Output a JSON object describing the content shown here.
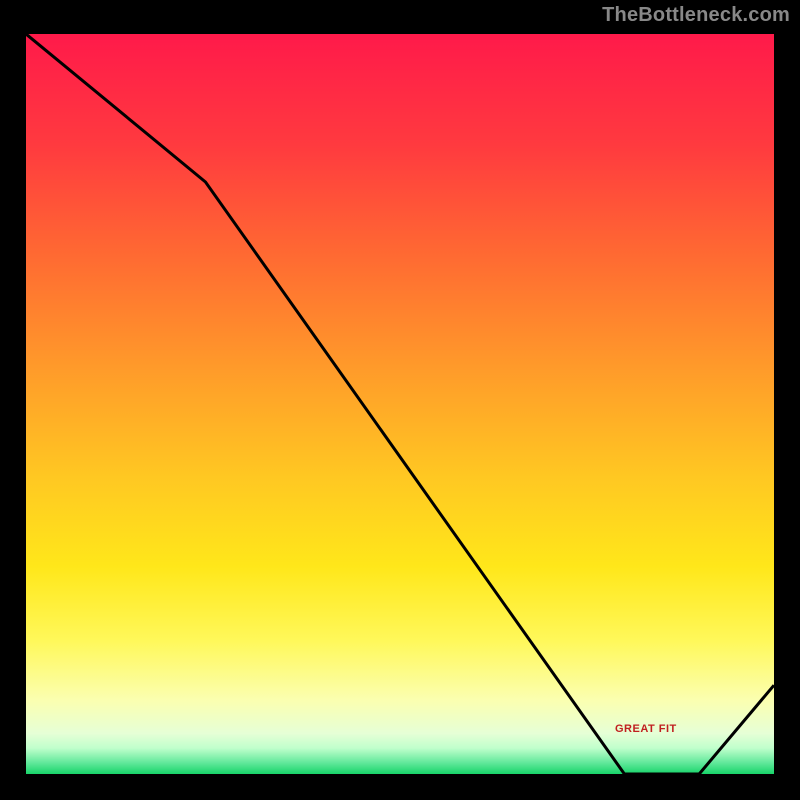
{
  "watermark": "TheBottleneck.com",
  "fit_label": "GREAT FIT",
  "colors": {
    "bg": "#000000",
    "curve": "#000000",
    "gradient_stops": [
      {
        "offset": 0.0,
        "color": "#ff1a4a"
      },
      {
        "offset": 0.15,
        "color": "#ff3a3f"
      },
      {
        "offset": 0.3,
        "color": "#ff6a32"
      },
      {
        "offset": 0.45,
        "color": "#ff9a2a"
      },
      {
        "offset": 0.6,
        "color": "#ffc822"
      },
      {
        "offset": 0.72,
        "color": "#ffe71a"
      },
      {
        "offset": 0.82,
        "color": "#fff85a"
      },
      {
        "offset": 0.9,
        "color": "#fbffb0"
      },
      {
        "offset": 0.945,
        "color": "#e6ffd6"
      },
      {
        "offset": 0.965,
        "color": "#c0ffcc"
      },
      {
        "offset": 0.985,
        "color": "#60e89a"
      },
      {
        "offset": 1.0,
        "color": "#18d46a"
      }
    ]
  },
  "chart_data": {
    "type": "line",
    "title": "",
    "xlabel": "",
    "ylabel": "",
    "x": [
      0.0,
      0.24,
      0.8,
      0.9,
      1.0
    ],
    "values": [
      1.0,
      0.8,
      0.0,
      0.0,
      0.12
    ],
    "ylim": [
      0,
      1
    ],
    "xlim": [
      0,
      1
    ],
    "fit_region_x": [
      0.8,
      0.9
    ],
    "notes": "x is normalized horizontal position; values is normalized bottleneck mismatch (0 = perfect fit / green, 1 = worst / red). Curve dips to 0 around x≈0.8–0.9 (GREAT FIT zone) then rises again."
  }
}
